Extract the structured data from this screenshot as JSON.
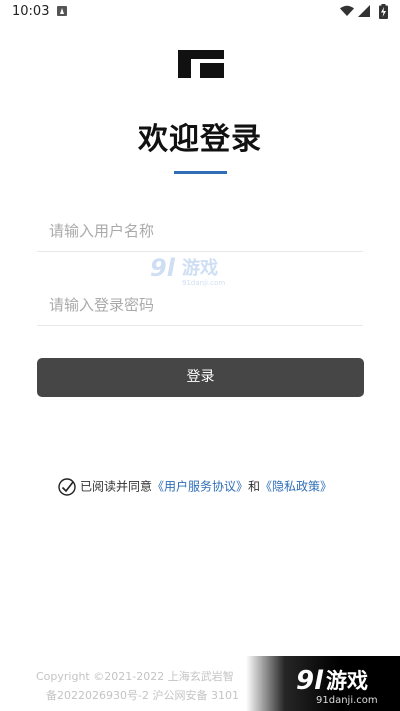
{
  "status_bar": {
    "time": "10:03"
  },
  "login": {
    "title": "欢迎登录",
    "username_placeholder": "请输入用户名称",
    "password_placeholder": "请输入登录密码",
    "login_button": "登录"
  },
  "agreement": {
    "prefix": "已阅读并同意",
    "user_agreement": "《用户服务协议》",
    "conjunction": "和",
    "privacy_policy": "《隐私政策》",
    "checked": true
  },
  "footer": {
    "copyright": "Copyright ©2021-2022 上海玄武岩智",
    "icp": "备2022026930号-2 沪公网安备 3101"
  },
  "watermark": {
    "brand": "9l游戏",
    "domain": "91danji.com"
  },
  "colors": {
    "accent": "#2f6eb7",
    "button_bg": "#464646",
    "placeholder": "#aaaaaa"
  }
}
